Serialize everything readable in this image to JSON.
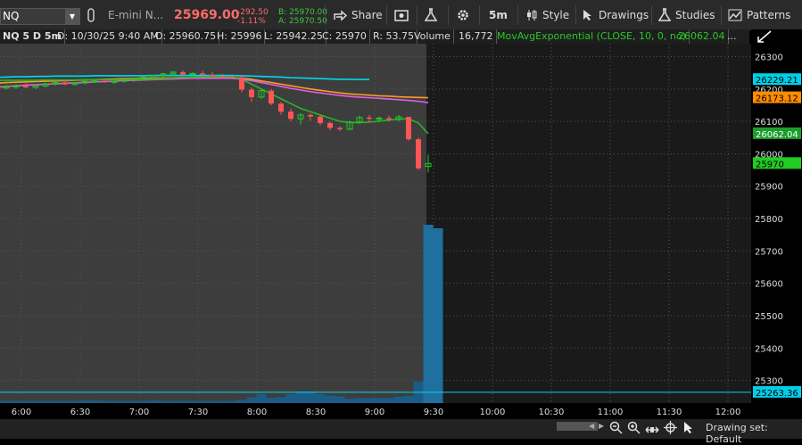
{
  "toolbar": {
    "symbol": "NQ",
    "description": "E-mini N...",
    "price": "25969.00",
    "change": "-292.50",
    "change_pct": "-1.11%",
    "bid": "B: 25970.00",
    "ask": "A: 25970.50",
    "share_label": "Share",
    "timeframe_label": "5m",
    "style_label": "Style",
    "drawings_label": "Drawings",
    "studies_label": "Studies",
    "patterns_label": "Patterns"
  },
  "infobar": {
    "symbol_tf": "NQ 5 D 5m",
    "date": "D: 10/30/25 9:40 AM",
    "open": "O: 25960.75",
    "high": "H: 25996",
    "low": "L: 25942.25",
    "close": "C: 25970",
    "rsi": "R: 53.75",
    "volume_label": "Volume",
    "volume_value": "16,772",
    "study": "MovAvgExponential (CLOSE, 10, 0, no)",
    "study_value": "26062.04",
    "more": "..."
  },
  "yaxis": {
    "ticks": [
      "26300",
      "26200",
      "26100",
      "26000",
      "25900",
      "25800",
      "25700",
      "25600",
      "25500",
      "25400",
      "25300"
    ],
    "badges": [
      {
        "label": "26229.21",
        "value": 26229.21,
        "color": "#00cfe8",
        "text": "#000"
      },
      {
        "label": "26173.12",
        "value": 26173.12,
        "color": "#ff8c00",
        "text": "#000"
      },
      {
        "label": "26062.04",
        "value": 26062.04,
        "color": "#1a9e2a",
        "text": "#fff"
      },
      {
        "label": "25970",
        "value": 25970,
        "color": "#22cc22",
        "text": "#000"
      },
      {
        "label": "25263.36",
        "value": 25263.36,
        "color": "#00cfe8",
        "text": "#000"
      }
    ]
  },
  "xaxis": {
    "ticks": [
      "6:00",
      "6:30",
      "7:00",
      "7:30",
      "8:00",
      "8:30",
      "9:00",
      "9:30",
      "10:00",
      "10:30",
      "11:00",
      "11:30",
      "12:00"
    ]
  },
  "bottom": {
    "drawing_set": "Drawing set: Default"
  },
  "chart_data": {
    "type": "candlestick",
    "ylim": [
      25230,
      26340
    ],
    "x_ticks": [
      "6:00",
      "6:30",
      "7:00",
      "7:30",
      "8:00",
      "8:30",
      "9:00",
      "9:30",
      "10:00",
      "10:30",
      "11:00",
      "11:30",
      "12:00"
    ],
    "y_ticks": [
      26300,
      26200,
      26100,
      26000,
      25900,
      25800,
      25700,
      25600,
      25500,
      25400,
      25300
    ],
    "candles": [
      [
        26198,
        26212,
        26192,
        26205
      ],
      [
        26203,
        26214,
        26198,
        26208
      ],
      [
        26206,
        26215,
        26200,
        26211
      ],
      [
        26209,
        26218,
        26203,
        26205
      ],
      [
        26205,
        26213,
        26200,
        26210
      ],
      [
        26209,
        26220,
        26205,
        26216
      ],
      [
        26216,
        26225,
        26210,
        26220
      ],
      [
        26220,
        26226,
        26212,
        26214
      ],
      [
        26214,
        26222,
        26210,
        26219
      ],
      [
        26219,
        26227,
        26214,
        26223
      ],
      [
        26223,
        26230,
        26218,
        26225
      ],
      [
        26225,
        26232,
        26219,
        26221
      ],
      [
        26221,
        26228,
        26216,
        26224
      ],
      [
        26224,
        26233,
        26220,
        26228
      ],
      [
        26228,
        26235,
        26222,
        26231
      ],
      [
        26231,
        26240,
        26226,
        26236
      ],
      [
        26236,
        26244,
        26230,
        26241
      ],
      [
        26241,
        26250,
        26236,
        26247
      ],
      [
        26247,
        26256,
        26240,
        26252
      ],
      [
        26252,
        26258,
        26242,
        26245
      ],
      [
        26245,
        26252,
        26238,
        26248
      ],
      [
        26248,
        26256,
        26240,
        26244
      ],
      [
        26244,
        26252,
        26236,
        26240
      ],
      [
        26240,
        26247,
        26232,
        26238
      ],
      [
        26238,
        26244,
        26230,
        26236
      ],
      [
        26236,
        26242,
        26190,
        26198
      ],
      [
        26198,
        26205,
        26160,
        26175
      ],
      [
        26175,
        26200,
        26170,
        26195
      ],
      [
        26195,
        26200,
        26150,
        26155
      ],
      [
        26155,
        26160,
        26120,
        26130
      ],
      [
        26130,
        26140,
        26100,
        26108
      ],
      [
        26108,
        26125,
        26090,
        26120
      ],
      [
        26120,
        26125,
        26102,
        26115
      ],
      [
        26115,
        26120,
        26088,
        26095
      ],
      [
        26095,
        26100,
        26072,
        26080
      ],
      [
        26080,
        26085,
        26070,
        26076
      ],
      [
        26076,
        26102,
        26072,
        26098
      ],
      [
        26098,
        26118,
        26092,
        26112
      ],
      [
        26112,
        26120,
        26096,
        26108
      ],
      [
        26108,
        26116,
        26098,
        26110
      ],
      [
        26110,
        26118,
        26100,
        26106
      ],
      [
        26106,
        26120,
        26100,
        26114
      ],
      [
        26114,
        26112,
        26040,
        26045
      ],
      [
        26045,
        26050,
        25950,
        25955
      ],
      [
        25960.75,
        25996,
        25942.25,
        25970
      ]
    ],
    "volume": [
      60,
      60,
      60,
      60,
      60,
      60,
      60,
      60,
      60,
      70,
      70,
      65,
      60,
      60,
      60,
      60,
      70,
      60,
      60,
      65,
      60,
      60,
      60,
      60,
      60,
      90,
      160,
      250,
      150,
      170,
      250,
      320,
      330,
      250,
      210,
      190,
      120,
      140,
      140,
      140,
      140,
      180,
      200,
      600,
      5000,
      4900
    ],
    "series": [
      {
        "name": "cyan",
        "color": "#00d8f0",
        "values": [
          26236,
          26237,
          26238,
          26238,
          26239,
          26239,
          26240,
          26240,
          26240,
          26240,
          26241,
          26241,
          26241,
          26241,
          26241,
          26241,
          26242,
          26242,
          26242,
          26242,
          26242,
          26242,
          26242,
          26242,
          26242,
          26241,
          26240,
          26239,
          26238,
          26237,
          26235,
          26234,
          26233,
          26232,
          26231,
          26230,
          26230,
          26229.5,
          26229.21
        ]
      },
      {
        "name": "orange",
        "color": "#ff9a2a",
        "values": [
          26218,
          26220,
          26221,
          26222,
          26223,
          26224,
          26225,
          26226,
          26227,
          26228,
          26229,
          26230,
          26231,
          26232,
          26232,
          26233,
          26234,
          26234,
          26235,
          26236,
          26236,
          26236,
          26236,
          26236,
          26236,
          26234,
          26230,
          26225,
          26220,
          26215,
          26210,
          26205,
          26200,
          26196,
          26192,
          26188,
          26185,
          26183,
          26181,
          26179,
          26178,
          26176,
          26175,
          26174,
          26173.12
        ]
      },
      {
        "name": "magenta",
        "color": "#e060e0",
        "values": [
          26206,
          26208,
          26210,
          26212,
          26213,
          26215,
          26216,
          26218,
          26219,
          26220,
          26222,
          26223,
          26224,
          26226,
          26227,
          26228,
          26229,
          26230,
          26231,
          26232,
          26233,
          26233,
          26233,
          26233,
          26233,
          26230,
          26226,
          26220,
          26214,
          26208,
          26202,
          26197,
          26192,
          26188,
          26184,
          26180,
          26177,
          26175,
          26173,
          26171,
          26169,
          26167,
          26165,
          26162,
          26158
        ]
      },
      {
        "name": "green",
        "color": "#28b428",
        "values": [
          26226,
          26227,
          26227,
          26227,
          26227,
          26228,
          26228,
          26228,
          26228,
          26229,
          26229,
          26229,
          26229,
          26229,
          26229,
          26230,
          26231,
          26232,
          26234,
          26235,
          26237,
          26238,
          26238,
          26238,
          26238,
          26230,
          26215,
          26200,
          26185,
          26170,
          26155,
          26140,
          26130,
          26120,
          26110,
          26100,
          26097,
          26096,
          26098,
          26101,
          26104,
          26107,
          26108,
          26095,
          26062.04
        ]
      }
    ],
    "reference_line": 25263.36
  },
  "colors": {
    "up": "#22cc22",
    "down": "#ff5555",
    "volume": "#1b5c85",
    "volume_current": "#1f6f9f",
    "history_bg": "#3d3d3d",
    "future_bg": "#1a1a1a"
  }
}
